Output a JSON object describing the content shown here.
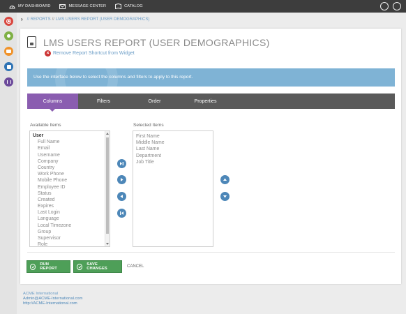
{
  "topnav": {
    "items": [
      "MY DASHBOARD",
      "MESSAGE CENTER",
      "CATALOG"
    ],
    "globe_icon": "globe-icon",
    "user_icon": "user-icon"
  },
  "rail": {
    "icons": [
      "settings-icon",
      "users-icon",
      "catalog-icon",
      "book-icon",
      "reports-icon"
    ],
    "colors": [
      "#d9463e",
      "#7fb044",
      "#f0932b",
      "#2f74b5",
      "#6c4a9b"
    ]
  },
  "breadcrumb": {
    "reports": "// REPORTS",
    "separator": "//",
    "current": "LMS USERS REPORT (USER DEMOGRAPHICS)"
  },
  "page": {
    "title": "LMS USERS REPORT (USER DEMOGRAPHICS)",
    "remove_shortcut": "Remove Report Shortcut from Widget"
  },
  "info": {
    "text": "Use the interface below to select the columns and filters to apply to this report."
  },
  "tabs": [
    "Columns",
    "Filters",
    "Order",
    "Properties"
  ],
  "available": {
    "label": "Available Items",
    "group": "User",
    "items": [
      "Full Name",
      "Email",
      "Username",
      "Company",
      "Country",
      "Work Phone",
      "Mobile Phone",
      "Employee ID",
      "Status",
      "Created",
      "Expires",
      "Last Login",
      "Language",
      "Local Timezone",
      "Group",
      "Supervisor",
      "Role"
    ]
  },
  "selected": {
    "label": "Selected Items",
    "items": [
      "First Name",
      "Middle Name",
      "Last Name",
      "Department",
      "Job Title"
    ]
  },
  "buttons": {
    "run": "RUN REPORT",
    "save": "SAVE CHANGES",
    "cancel": "CANCEL"
  },
  "footer": {
    "company": "ACME International",
    "email": "Admin@ACME-International.com",
    "url": "http://ACME-International.com"
  },
  "colors": {
    "accent_purple": "#8a5db0",
    "info_blue": "#7fb3d5",
    "button_green": "#4e9f58",
    "control_blue": "#4d87b8"
  }
}
